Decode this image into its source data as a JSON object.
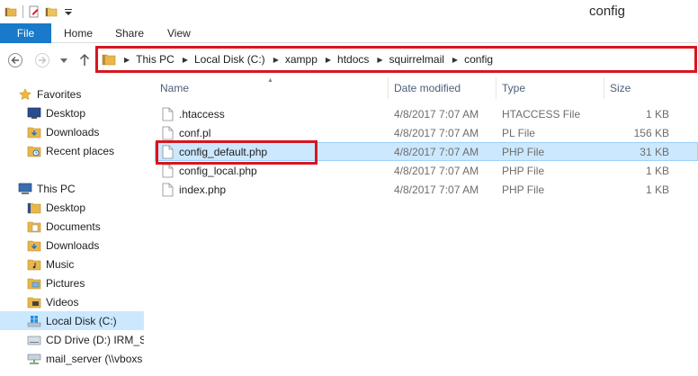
{
  "window": {
    "title": "config"
  },
  "ribbon": {
    "tabs": [
      "File",
      "Home",
      "Share",
      "View"
    ]
  },
  "address": {
    "crumbs": [
      "This PC",
      "Local Disk (C:)",
      "xampp",
      "htdocs",
      "squirrelmail",
      "config"
    ]
  },
  "nav": {
    "favorites_label": "Favorites",
    "favorites": [
      "Desktop",
      "Downloads",
      "Recent places"
    ],
    "thispc_label": "This PC",
    "thispc_items": [
      "Desktop",
      "Documents",
      "Downloads",
      "Music",
      "Pictures",
      "Videos",
      "Local Disk (C:)",
      "CD Drive (D:) IRM_SS",
      "mail_server (\\\\vboxs"
    ],
    "selected_item": "Local Disk (C:)"
  },
  "columns": {
    "name": "Name",
    "date": "Date modified",
    "type": "Type",
    "size": "Size"
  },
  "files": [
    {
      "name": ".htaccess",
      "date": "4/8/2017 7:07 AM",
      "type": "HTACCESS File",
      "size": "1 KB"
    },
    {
      "name": "conf.pl",
      "date": "4/8/2017 7:07 AM",
      "type": "PL File",
      "size": "156 KB"
    },
    {
      "name": "config_default.php",
      "date": "4/8/2017 7:07 AM",
      "type": "PHP File",
      "size": "31 KB"
    },
    {
      "name": "config_local.php",
      "date": "4/8/2017 7:07 AM",
      "type": "PHP File",
      "size": "1 KB"
    },
    {
      "name": "index.php",
      "date": "4/8/2017 7:07 AM",
      "type": "PHP File",
      "size": "1 KB"
    }
  ],
  "selected_file": "config_default.php",
  "colors": {
    "accent": "#1979ca",
    "highlight": "#d7161f",
    "selection": "#cce8ff",
    "folder": "#e8b64a"
  }
}
